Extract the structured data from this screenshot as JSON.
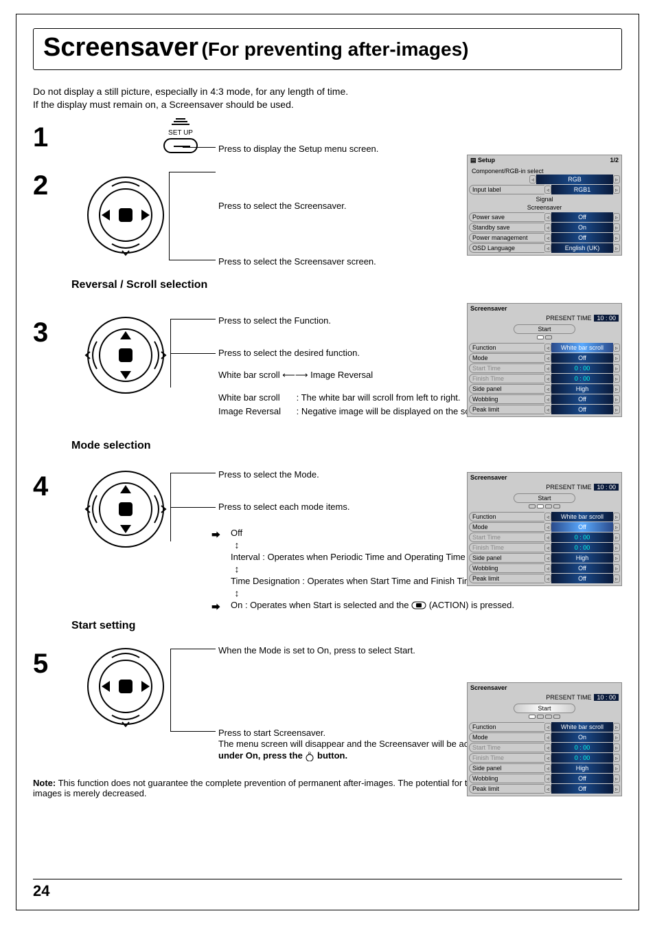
{
  "title": {
    "main": "Screensaver",
    "sub": "(For preventing after-images)"
  },
  "intro": {
    "l1": "Do not display a still picture, especially in 4:3 mode, for any length of time.",
    "l2": "If the display must remain on, a Screensaver should be used."
  },
  "steps": {
    "s1": {
      "num": "1",
      "setup_label": "SET UP",
      "text": "Press to display the Setup menu screen."
    },
    "s2": {
      "num": "2",
      "t1": "Press to select the Screensaver.",
      "t2": "Press to select the Screensaver screen."
    },
    "s3": {
      "num": "3",
      "heading": "Reversal / Scroll selection",
      "t1": "Press to select the Function.",
      "t2": "Press to select the desired function.",
      "toggle_left": "White bar scroll",
      "toggle_right": "Image Reversal",
      "desc1_label": "White bar scroll",
      "desc1_text": ": The white bar will scroll from left to right.",
      "desc2_label": "Image Reversal",
      "desc2_text": ": Negative image will be displayed on the screen."
    },
    "s4": {
      "num": "4",
      "heading": "Mode selection",
      "t1": "Press to select the Mode.",
      "t2": "Press to select each mode items.",
      "off": "Off",
      "interval": "Interval : Operates when Periodic Time and Operating Time are setup and those times arrive.",
      "timed": "Time Designation : Operates when Start Time and Finish Time are setup and those times arrive.",
      "on": "On : Operates when Start is selected and the",
      "on_tail": "(ACTION) is pressed."
    },
    "s5": {
      "num": "5",
      "heading": "Start setting",
      "t1": "When the Mode is set to On, press to select Start.",
      "t2": "Press to start Screensaver.",
      "t3a": "The menu screen will disappear and the Screensaver will be activated. ",
      "t3b": "To stop the Screensaver under On, press the ",
      "t3c": " button."
    }
  },
  "note": {
    "label": "Note:",
    "text": " This function does not guarantee the complete prevention of permanent after-images. The potential for the occurrence of permanent after-images is merely decreased."
  },
  "page_number": "24",
  "osd_setup": {
    "title": "Setup",
    "page": "1/2",
    "rows": [
      {
        "label": "Component/RGB-in  select",
        "value": "RGB",
        "span": true
      },
      {
        "label": "Input label",
        "value": "RGB1"
      },
      {
        "label": "Signal",
        "centered": true
      },
      {
        "label": "Screensaver",
        "centered": true
      },
      {
        "label": "Power save",
        "value": "Off"
      },
      {
        "label": "Standby save",
        "value": "On"
      },
      {
        "label": "Power management",
        "value": "Off"
      },
      {
        "label": "OSD  Language",
        "value": "English (UK)"
      }
    ]
  },
  "osd_ss": {
    "title": "Screensaver",
    "present_label": "PRESENT TIME",
    "present_value": "10 : 00",
    "start_label": "Start",
    "rows": [
      {
        "label": "Function",
        "value": "White bar scroll",
        "hl": true
      },
      {
        "label": "Mode",
        "value": "Off"
      },
      {
        "label": "Start Time",
        "value": "0 : 00",
        "disabled": true
      },
      {
        "label": "Finish Time",
        "value": "0 : 00",
        "disabled": true
      },
      {
        "label": "Side  panel",
        "value": "High"
      },
      {
        "label": "Wobbling",
        "value": "Off"
      },
      {
        "label": "Peak limit",
        "value": "Off"
      }
    ]
  },
  "osd_ss2_mode": "Off",
  "osd_ss3_mode": "On"
}
